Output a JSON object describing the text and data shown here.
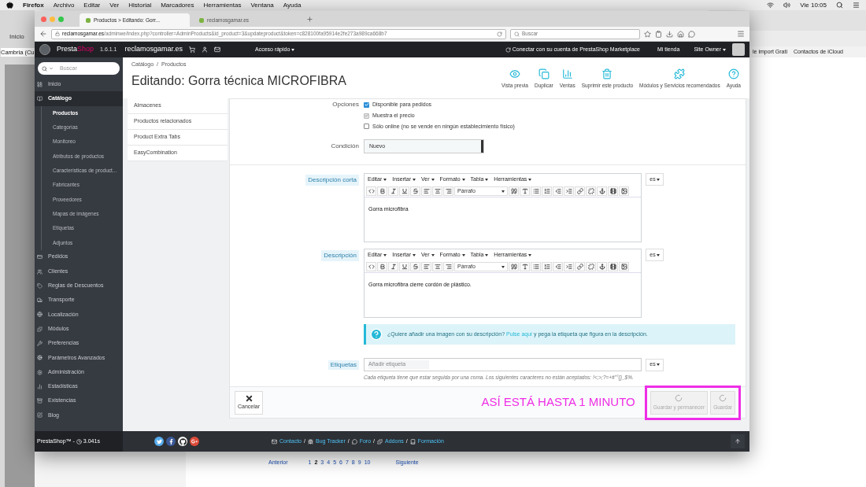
{
  "menubar": {
    "app": "Firefox",
    "menus": [
      "Archivo",
      "Editar",
      "Ver",
      "Historial",
      "Marcadores",
      "Herramientas",
      "Ventana",
      "Ayuda"
    ],
    "clock": "Vie 10:05"
  },
  "background_left": {
    "tab": "Inicio",
    "font": "Cambria (Cu"
  },
  "background_right": {
    "bookmarks": [
      "le import Grati",
      "Contactos de iCloud"
    ]
  },
  "background_pager": {
    "prev": "Anterior",
    "next": "Siguiente",
    "pages": [
      {
        "label": "1",
        "selected": false
      },
      {
        "label": "2",
        "selected": true
      },
      {
        "label": "3",
        "selected": false
      },
      {
        "label": "4",
        "selected": false
      },
      {
        "label": "5",
        "selected": false
      },
      {
        "label": "6",
        "selected": false
      },
      {
        "label": "7",
        "selected": false
      },
      {
        "label": "8",
        "selected": false
      },
      {
        "label": "9",
        "selected": false
      },
      {
        "label": "10",
        "selected": false
      }
    ]
  },
  "browser": {
    "tabs": [
      {
        "label": "Productos > Editando: Gorr...",
        "selected": true
      },
      {
        "label": "reclamosgamar.es",
        "selected": false
      }
    ],
    "url_host": "reclamosgamar.es",
    "url_path": "/adminwe/index.php?controller=AdminProducts&id_product=3&updateproduct&token=c828100fa95914e2fe273a989ca668b7",
    "search_placeholder": "Buscar"
  },
  "topbar": {
    "brand_presta": "Presta",
    "brand_shop": "Shop",
    "version": "1.6.1.1",
    "shop": "reclamosgamar.es",
    "quick_access": "Acceso rápido",
    "connect": "Conectar con su cuenta de PrestaShop Marketplace",
    "my_shop": "Mi tienda",
    "user": "Site Owner"
  },
  "sidebar": {
    "search_placeholder": "Buscar",
    "items": [
      {
        "label": "Inicio",
        "selected": false
      },
      {
        "label": "Catálogo",
        "selected": true,
        "children": [
          {
            "label": "Productos",
            "selected": true
          },
          {
            "label": "Categorías",
            "selected": false
          },
          {
            "label": "Monitoreo",
            "selected": false
          },
          {
            "label": "Atributos de productos",
            "selected": false
          },
          {
            "label": "Características de product...",
            "selected": false
          },
          {
            "label": "Fabricantes",
            "selected": false
          },
          {
            "label": "Proveedores",
            "selected": false
          },
          {
            "label": "Mapas de imágenes",
            "selected": false
          },
          {
            "label": "Etiquetas",
            "selected": false
          },
          {
            "label": "Adjuntos",
            "selected": false
          }
        ]
      },
      {
        "label": "Pedidos",
        "selected": false
      },
      {
        "label": "Clientes",
        "selected": false
      },
      {
        "label": "Reglas de Descuentos",
        "selected": false
      },
      {
        "label": "Transporte",
        "selected": false
      },
      {
        "label": "Localización",
        "selected": false
      },
      {
        "label": "Módulos",
        "selected": false
      },
      {
        "label": "Preferencias",
        "selected": false
      },
      {
        "label": "Parámetros Avanzados",
        "selected": false
      },
      {
        "label": "Administración",
        "selected": false
      },
      {
        "label": "Estadísticas",
        "selected": false
      },
      {
        "label": "Existencias",
        "selected": false
      },
      {
        "label": "Blog",
        "selected": false
      }
    ]
  },
  "header": {
    "breadcrumb": [
      "Catálogo",
      "Productos"
    ],
    "breadcrumb_separator": "/",
    "title": "Editando: Gorra técnica MICROFIBRA",
    "actions": [
      "Vista previa",
      "Duplicar",
      "Ventas",
      "Suprimir este producto",
      "Módulos y Servicios recomendados",
      "Ayuda"
    ]
  },
  "product_tabs": [
    {
      "label": "Almacenes",
      "selected": false
    },
    {
      "label": "Productos relacionados",
      "selected": false
    },
    {
      "label": "Product Extra Tabs",
      "selected": false
    },
    {
      "label": "EasyCombination",
      "selected": false
    }
  ],
  "form": {
    "options_label": "Opciones",
    "options": [
      {
        "label": "Disponible para pedidos",
        "checked": true,
        "disabled": false
      },
      {
        "label": "Muestra el precio",
        "checked": true,
        "disabled": true
      },
      {
        "label": "Sólo online (no se vende en ningún establecimiento físico)",
        "checked": false,
        "disabled": false
      }
    ],
    "condition_label": "Condición",
    "condition_value": "Nuevo",
    "editors": [
      {
        "label": "Descripción corta",
        "menus": [
          "Editar",
          "Insertar",
          "Ver",
          "Formato",
          "Tabla",
          "Herramientas"
        ],
        "format": "Párrafo",
        "content": "Gorra microfibra",
        "lang": "es"
      },
      {
        "label": "Descripción",
        "menus": [
          "Editar",
          "Insertar",
          "Ver",
          "Formato",
          "Tabla",
          "Herramientas"
        ],
        "format": "Párrafo",
        "content": "Gorra microfibra cierre cordón de plástico.",
        "lang": "es"
      }
    ],
    "info": {
      "before": "¿Quiere añadir una imagen con su descripción?",
      "link": "Pulse aquí",
      "after": "y pega la etiqueta que figura en la descripción."
    },
    "tags": {
      "label": "Etiquetas",
      "placeholder": "Añadir etiqueta",
      "lang": "es",
      "help": "Cada etiqueta tiene que estar seguida por una coma. Los siguientes caracteres no están aceptados: !<;>;?=+#\"°{}_$%."
    }
  },
  "panel_footer": {
    "cancel": "Cancelar",
    "annotation": "ASÍ ESTÁ HASTA 1 MINUTO",
    "save_buttons": [
      {
        "label": "Guardar y permanecer",
        "disabled": true
      },
      {
        "label": "Guardar",
        "disabled": true
      }
    ]
  },
  "footer": {
    "brand": "PrestaShop™ -",
    "time": "3.041s",
    "links": [
      "Contacto",
      "Bug Tracker",
      "Foro",
      "Addons",
      "Formación"
    ],
    "separator": "/"
  }
}
